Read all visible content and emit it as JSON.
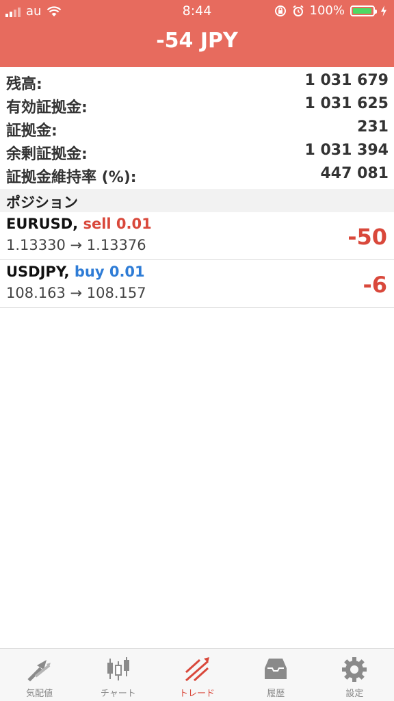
{
  "status_bar": {
    "carrier": "au",
    "time": "8:44",
    "battery": "100%"
  },
  "header": {
    "total_profit": "-54 JPY"
  },
  "account": [
    {
      "label": "残高:",
      "value": "1 031 679"
    },
    {
      "label": "有効証拠金:",
      "value": "1 031 625"
    },
    {
      "label": "証拠金:",
      "value": "231"
    },
    {
      "label": "余剰証拠金:",
      "value": "1 031 394"
    },
    {
      "label": "証拠金維持率 (%):",
      "value": "447 081"
    }
  ],
  "positions_section": {
    "title": "ポジション"
  },
  "positions": [
    {
      "symbol": "EURUSD,",
      "type": "sell 0.01",
      "prices": "1.13330 → 1.13376",
      "profit": "-50"
    },
    {
      "symbol": "USDJPY,",
      "type": "buy 0.01",
      "prices": "108.163 → 108.157",
      "profit": "-6"
    }
  ],
  "tabs": [
    {
      "label": "気配値",
      "icon": "quotes-icon"
    },
    {
      "label": "チャート",
      "icon": "chart-icon"
    },
    {
      "label": "トレード",
      "icon": "trade-icon"
    },
    {
      "label": "履歴",
      "icon": "history-icon"
    },
    {
      "label": "設定",
      "icon": "settings-icon"
    }
  ],
  "colors": {
    "header_bg": "#E76B5E",
    "sell": "#D9483B",
    "buy": "#2E7CD6",
    "loss": "#D9483B",
    "active_tab": "#D9483B",
    "inactive_tab": "#8A8A8A"
  }
}
